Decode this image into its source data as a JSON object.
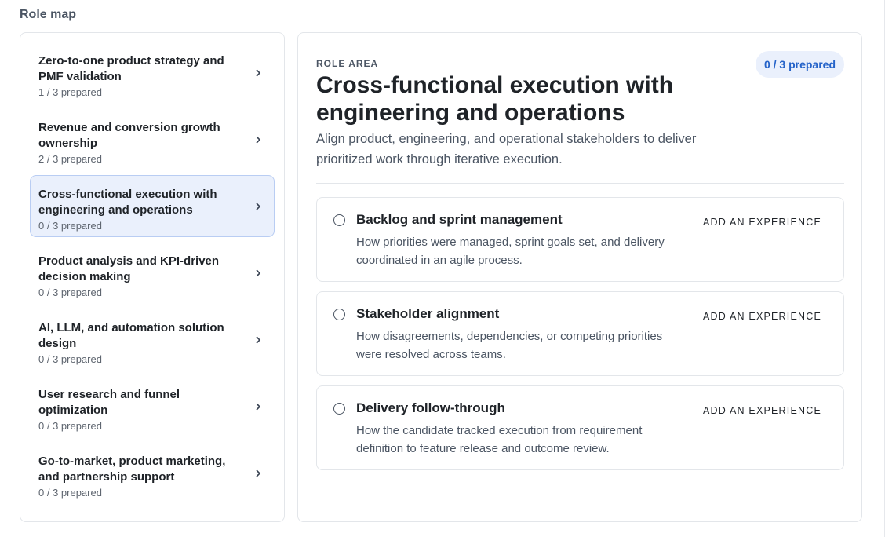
{
  "header": {
    "title": "Role map"
  },
  "sidebar": {
    "items": [
      {
        "label": "Zero-to-one product strategy and PMF validation",
        "count": "1 / 3 prepared"
      },
      {
        "label": "Revenue and conversion growth ownership",
        "count": "2 / 3 prepared"
      },
      {
        "label": "Cross-functional execution with engineering and operations",
        "count": "0 / 3 prepared",
        "active": true
      },
      {
        "label": "Product analysis and KPI-driven decision making",
        "count": "0 / 3 prepared"
      },
      {
        "label": "AI, LLM, and automation solution design",
        "count": "0 / 3 prepared"
      },
      {
        "label": "User research and funnel optimization",
        "count": "0 / 3 prepared"
      },
      {
        "label": "Go-to-market, product marketing, and partnership support",
        "count": "0 / 3 prepared"
      }
    ],
    "chevron_icon": "chevron-right-icon"
  },
  "main": {
    "eyebrow": "ROLE AREA",
    "badge": "0 / 3 prepared",
    "title": "Cross-functional execution with engineering and operations",
    "description": "Align product, engineering, and operational stakeholders to deliver prioritized work through iterative execution.",
    "experiences": [
      {
        "title": "Backlog and sprint management",
        "description": "How priorities were managed, sprint goals set, and delivery coordinated in an agile process.",
        "action": "ADD AN EXPERIENCE"
      },
      {
        "title": "Stakeholder alignment",
        "description": "How disagreements, dependencies, or competing priorities were resolved across teams.",
        "action": "ADD AN EXPERIENCE"
      },
      {
        "title": "Delivery follow-through",
        "description": "How the candidate tracked execution from requirement definition to feature release and outcome review.",
        "action": "ADD AN EXPERIENCE"
      }
    ]
  },
  "colors": {
    "accent": "#2563c9",
    "active_bg": "#eaf0fc",
    "border": "#e3e6ea"
  }
}
